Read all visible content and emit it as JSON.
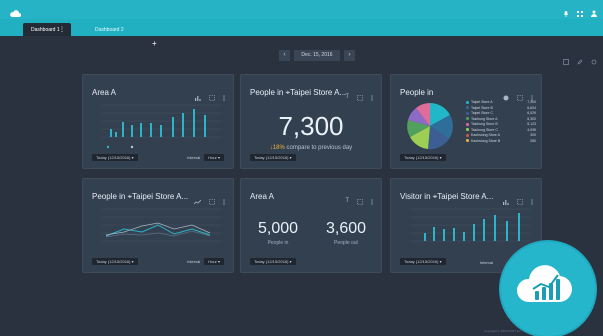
{
  "colors": {
    "accent": "#26b0c4",
    "bg": "#2a3240",
    "card": "#334050",
    "bar": "#2cb5c9"
  },
  "tabs": [
    {
      "label": "Dashboard 1"
    },
    {
      "label": "Dashboard 2"
    }
  ],
  "date": {
    "label": "Dec. 15, 2016"
  },
  "cards": {
    "areaA": {
      "title": "Area A",
      "footer": "Today (12/15/2016)",
      "interval_label": "Interval",
      "interval_value": "Hour"
    },
    "people": {
      "title": "People in",
      "location": "Taipei Store A...",
      "value": "7,300",
      "delta": "↓18%",
      "delta_text": "compare to previous day",
      "footer": "Today (12/15/2016)"
    },
    "pie": {
      "title": "People in",
      "footer": "Today (12/15/2016)",
      "legend": [
        {
          "name": "Taipei Store A",
          "value": "7,300",
          "color": "#20b7c9"
        },
        {
          "name": "Taipei Store B",
          "value": "6,604",
          "color": "#2f6e9a"
        },
        {
          "name": "Taipei Store C",
          "value": "6,029",
          "color": "#3d5e94"
        },
        {
          "name": "Taichung Store A",
          "value": "5,300",
          "color": "#52a05d"
        },
        {
          "name": "Taichung Store B",
          "value": "5,123",
          "color": "#e06c9b"
        },
        {
          "name": "Taichung Store C",
          "value": "4,935",
          "color": "#9dcf54"
        },
        {
          "name": "Kaohsiung Store A",
          "value": "300",
          "color": "#cc5a4e"
        },
        {
          "name": "Kaohsiung Store B",
          "value": "250",
          "color": "#f2b53b"
        }
      ]
    },
    "peopleLine": {
      "title": "People in",
      "location": "Taipei Store A...",
      "footer": "Today (12/15/2016)",
      "interval_label": "Interval",
      "interval_value": "Hour"
    },
    "areaA2": {
      "title": "Area A",
      "left_value": "5,000",
      "left_label": "People in",
      "right_value": "3,600",
      "right_label": "People out",
      "footer": "Today (12/15/2016)"
    },
    "visitor": {
      "title": "Visitor in",
      "location": "Taipei Store A...",
      "footer": "Today (12/15/2016)",
      "interval_label": "Interval"
    }
  },
  "copyright": "Copyright © 2016 IOWT Inc. ..."
}
